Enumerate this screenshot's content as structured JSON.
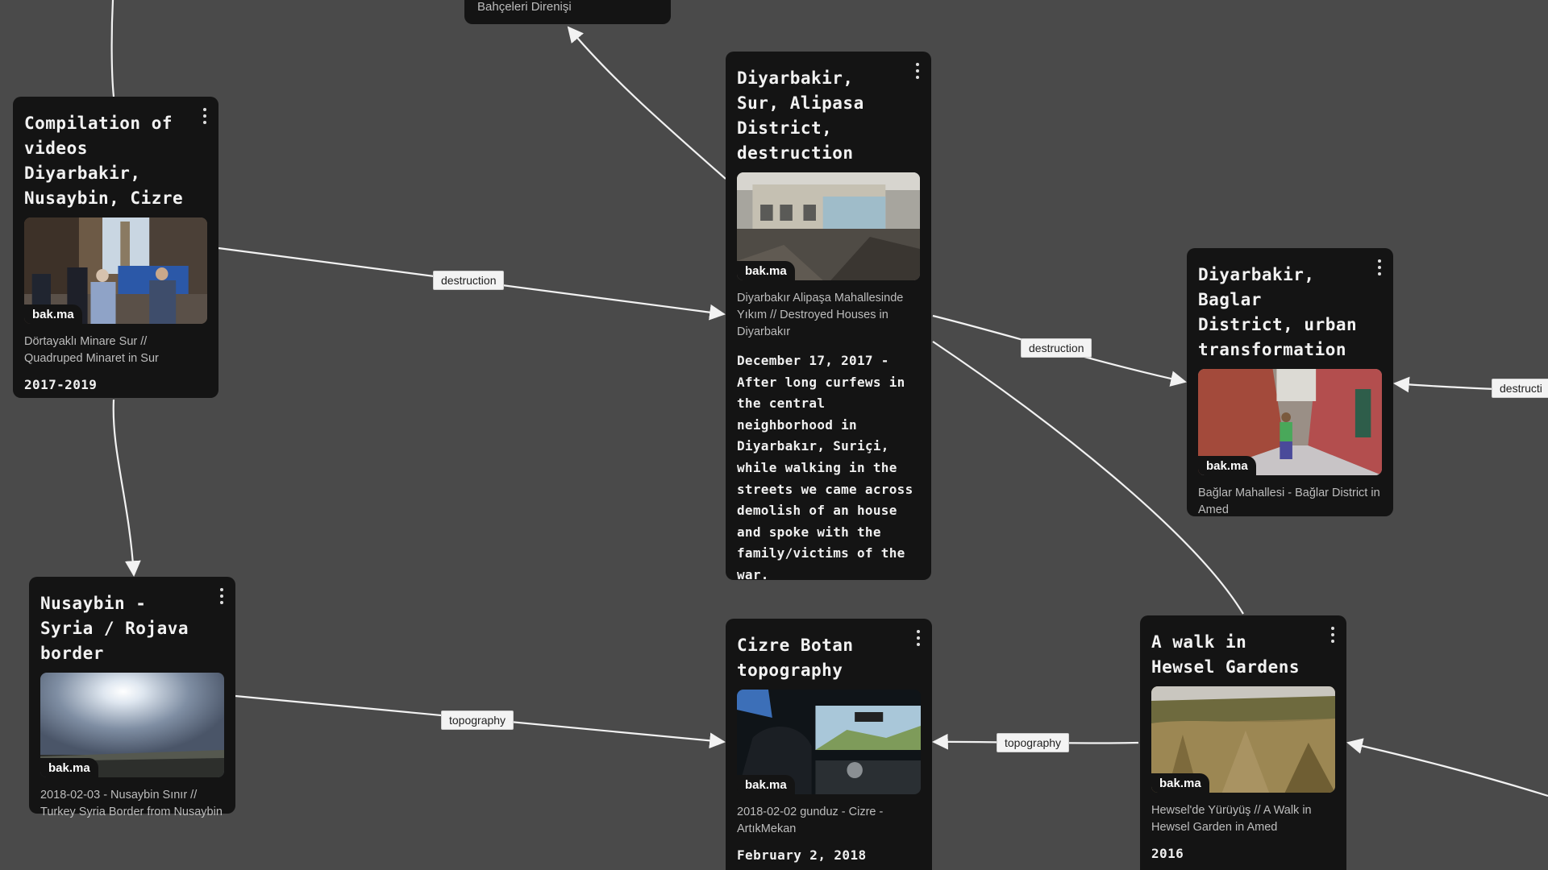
{
  "colors": {
    "canvas_bg": "#4a4a4a",
    "node_bg": "#141414",
    "edge": "#f2f2f2",
    "label_bg": "#f3f3f3"
  },
  "badge_label": "bak.ma",
  "partial_node": {
    "caption": "Bahçeleri Direnişi"
  },
  "nodes": {
    "compilation": {
      "title": "Compilation of videos Diyarbakir, Nusaybin, Cizre",
      "caption": "Dörtayaklı Minare Sur // Quadruped Minaret in Sur",
      "date": "2017-2019",
      "thumb_icon": "minaret-street-thumbnail"
    },
    "alipasa": {
      "title": "Diyarbakir, Sur, Alipasa District, destruction",
      "caption": "Diyarbakır Alipaşa Mahallesinde Yıkım // Destroyed Houses in Diyarbakır",
      "description": "December 17, 2017 - After long curfews in the central neighborhood in Diyarbakır, Suriçi, while walking in the streets we came across demolish of an house and spoke with the family/victims of the war.",
      "thumb_icon": "destroyed-houses-thumbnail"
    },
    "baglar": {
      "title": "Diyarbakir, Baglar District, urban transformation",
      "caption": "Bağlar Mahallesi - Bağlar District in Amed",
      "thumb_icon": "alley-child-thumbnail"
    },
    "nusaybin": {
      "title": "Nusaybin - Syria / Rojava border",
      "caption": "2018-02-03 - Nusaybin Sınır // Turkey Syria Border from Nusaybin",
      "thumb_icon": "sun-sky-thumbnail"
    },
    "cizre": {
      "title": "Cizre Botan topography",
      "caption": "2018-02-02 gunduz - Cizre - ArtıkMekan",
      "date": "February 2, 2018",
      "thumb_icon": "car-interior-thumbnail"
    },
    "hewsel": {
      "title": "A walk in Hewsel Gardens",
      "caption": "Hewsel'de Yürüyüş // A Walk in Hewsel Garden in Amed",
      "date": "2016",
      "thumb_icon": "garden-field-thumbnail"
    }
  },
  "edge_labels": {
    "compilation_to_alipasa": "destruction",
    "alipasa_to_baglar": "destruction",
    "offscreen_to_baglar": "destructi",
    "nusaybin_to_cizre": "topography",
    "hewsel_to_cizre": "topography"
  }
}
